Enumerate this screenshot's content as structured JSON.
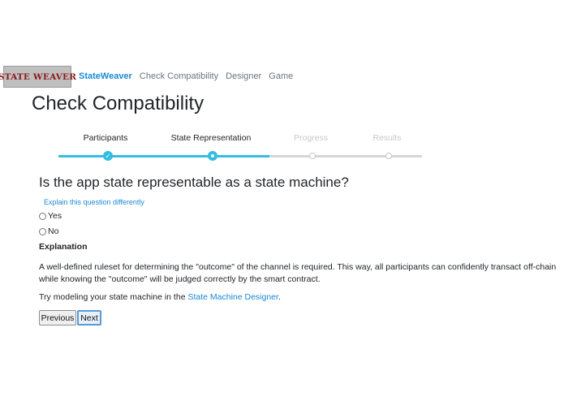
{
  "navbar": {
    "logo_text": "STATE WEAVER",
    "brand": "StateWeaver",
    "links": [
      "Check Compatibility",
      "Designer",
      "Game"
    ]
  },
  "page": {
    "title": "Check Compatibility"
  },
  "stepper": {
    "steps": [
      {
        "label": "Participants",
        "state": "completed"
      },
      {
        "label": "State Representation",
        "state": "current"
      },
      {
        "label": "Progress",
        "state": "pending"
      },
      {
        "label": "Results",
        "state": "pending"
      }
    ],
    "colors": {
      "done": "#33bde1",
      "todo": "#d6d6d6"
    }
  },
  "question": {
    "text": "Is the app state representable as a state machine?",
    "explain_link": "Explain this question differently",
    "options": [
      {
        "label": "Yes",
        "selected": false
      },
      {
        "label": "No",
        "selected": false
      }
    ]
  },
  "explanation": {
    "heading": "Explanation",
    "body": "A well-defined ruleset for determining the \"outcome\" of the channel is required. This way, all participants can confidently transact off-chain while knowing the \"outcome\" will be judged correctly by the smart contract.",
    "hint_prefix": "Try modeling your state machine in the ",
    "hint_link": "State Machine Designer",
    "hint_suffix": "."
  },
  "buttons": {
    "previous": "Previous",
    "next": "Next"
  },
  "colors": {
    "link": "#1a8ad4",
    "logo_text": "#8b1a1a"
  },
  "icons": {
    "completed_step": "check-icon",
    "current_step": "dot-icon",
    "pending_step": "circle-icon"
  }
}
